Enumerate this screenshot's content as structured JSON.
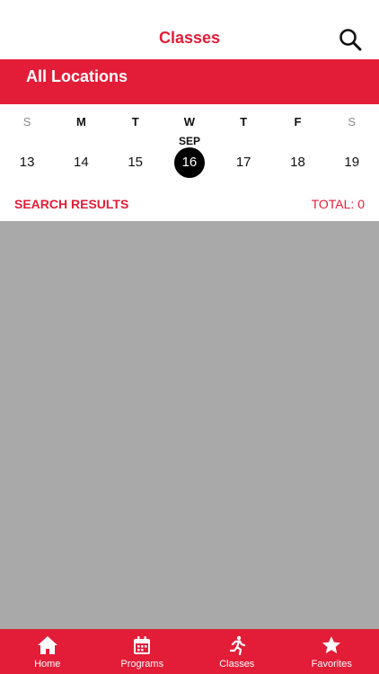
{
  "header": {
    "title": "Classes",
    "search_icon": "search-icon"
  },
  "location": {
    "label": "All Locations"
  },
  "calendar": {
    "month": "SEP",
    "weekdays": [
      "S",
      "M",
      "T",
      "W",
      "T",
      "F",
      "S"
    ],
    "days": [
      "13",
      "14",
      "15",
      "16",
      "17",
      "18",
      "19"
    ],
    "selected_day": "16"
  },
  "results": {
    "label": "SEARCH RESULTS",
    "total_label": "TOTAL: 0"
  },
  "tabbar": {
    "tabs": [
      {
        "label": "Home",
        "icon": "home-icon"
      },
      {
        "label": "Programs",
        "icon": "calendar-icon"
      },
      {
        "label": "Classes",
        "icon": "runner-icon"
      },
      {
        "label": "Favorites",
        "icon": "star-icon"
      }
    ]
  },
  "colors": {
    "accent": "#e31d37",
    "results_background": "#a9a9a9",
    "selected_day_background": "#000000"
  }
}
